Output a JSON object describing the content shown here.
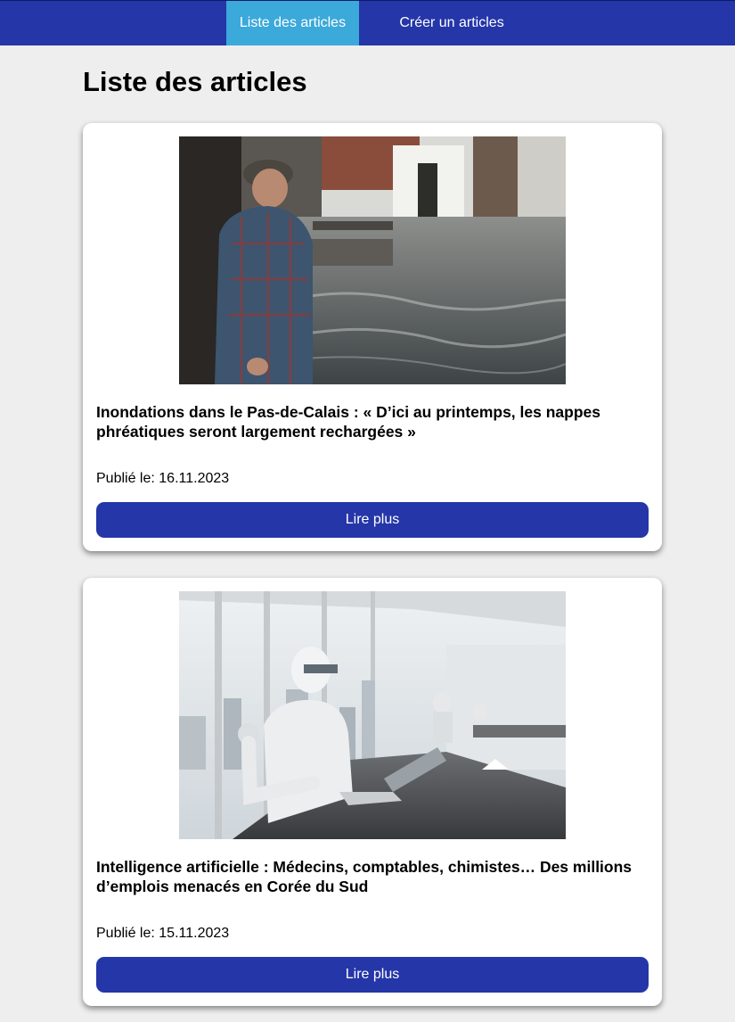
{
  "nav": {
    "items": [
      {
        "label": "Liste des articles",
        "active": true
      },
      {
        "label": "Créer un articles",
        "active": false
      }
    ]
  },
  "page": {
    "title": "Liste des articles"
  },
  "articles": [
    {
      "title": "Inondations dans le Pas-de-Calais : « D’ici au printemps, les nappes phréatiques seront largement rechargées »",
      "date_prefix": "Publié le:",
      "date": "16.11.2023",
      "date_line": "Publié le: 16.11.2023",
      "button_label": "Lire plus"
    },
    {
      "title": "Intelligence artificielle : Médecins, comptables, chimistes… Des millions d’emplois menacés en Corée du Sud",
      "date_prefix": "Publié le:",
      "date": "15.11.2023",
      "date_line": "Publié le: 15.11.2023",
      "button_label": "Lire plus"
    }
  ],
  "colors": {
    "nav_bg": "#2436a8",
    "nav_active": "#3ba9d9",
    "button_bg": "#2436a8",
    "page_bg": "#eeeeee"
  }
}
